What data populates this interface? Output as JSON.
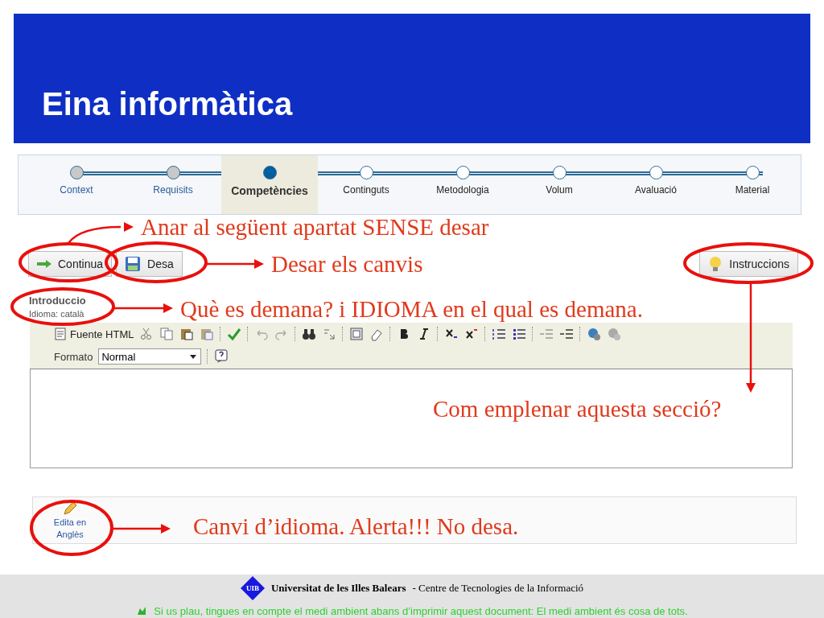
{
  "title": "Eina informàtica",
  "steps": [
    {
      "label": "Context",
      "completed": true,
      "selected": false
    },
    {
      "label": "Requisits",
      "completed": true,
      "selected": false
    },
    {
      "label": "Competències",
      "completed": false,
      "selected": true
    },
    {
      "label": "Continguts",
      "completed": false,
      "selected": false
    },
    {
      "label": "Metodologia",
      "completed": false,
      "selected": false
    },
    {
      "label": "Volum",
      "completed": false,
      "selected": false
    },
    {
      "label": "Avaluació",
      "completed": false,
      "selected": false
    },
    {
      "label": "Material",
      "completed": false,
      "selected": false
    }
  ],
  "actions": {
    "continue": "Continua",
    "save": "Desa",
    "instructions": "Instruccions"
  },
  "section": {
    "title": "Introduccio",
    "language": "Idioma: català"
  },
  "editor": {
    "source_button": "Fuente HTML",
    "format_label": "Formato",
    "format_value": "Normal"
  },
  "edit_language": "Edita en Anglès",
  "annotations": [
    {
      "text": "Anar al següent apartat SENSE desar"
    },
    {
      "text": "Desar els canvis"
    },
    {
      "text": "Què es demana? i IDIOMA en el qual es demana."
    },
    {
      "text": "Com emplenar aquesta secció?"
    },
    {
      "text": "Canvi d’idioma. Alerta!!! No desa."
    }
  ],
  "footer": {
    "logo": "UIB",
    "institution": "Universitat de les Illes Balears",
    "centre": "- Centre de Tecnologies de la Informació",
    "notice": "Si us plau, tingues en compte el medi ambient abans d’imprimir aquest document: El medi ambient és cosa de tots."
  }
}
